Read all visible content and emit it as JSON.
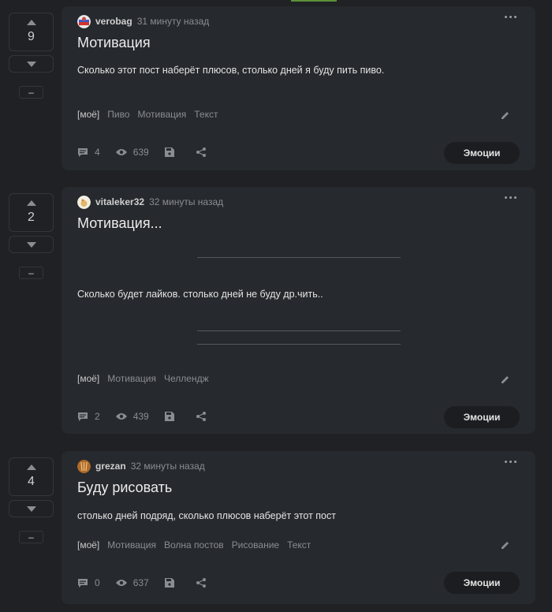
{
  "posts": [
    {
      "rating": "9",
      "hide_label": "–",
      "author": "verobag",
      "time": "31 минуту назад",
      "title": "Мотивация",
      "text": "Сколько этот пост наберёт плюсов, столько дней я буду пить пиво.",
      "tags": [
        "[моё]",
        "Пиво",
        "Мотивация",
        "Текст"
      ],
      "comments": "4",
      "views": "639",
      "emotions_label": "Эмоции"
    },
    {
      "rating": "2",
      "hide_label": "–",
      "author": "vitaleker32",
      "time": "32 минуты назад",
      "title": "Мотивация...",
      "text": "Сколько будет лайков. столько дней не буду др.чить..",
      "tags": [
        "[моё]",
        "Мотивация",
        "Челлендж"
      ],
      "comments": "2",
      "views": "439",
      "emotions_label": "Эмоции"
    },
    {
      "rating": "4",
      "hide_label": "–",
      "author": "grezan",
      "time": "32 минуты назад",
      "title": "Буду рисовать",
      "text": "столько дней подряд, сколько плюсов наберёт этот пост",
      "tags": [
        "[моё]",
        "Мотивация",
        "Волна постов",
        "Рисование",
        "Текст"
      ],
      "comments": "0",
      "views": "637",
      "emotions_label": "Эмоции"
    }
  ],
  "icons": {
    "comments": "comment-icon",
    "views": "eye-icon",
    "save": "save-icon",
    "share": "share-icon",
    "edit": "pencil-icon",
    "more": "more-dots-icon",
    "upvote": "upvote-arrow-icon",
    "downvote": "downvote-arrow-icon"
  },
  "colors": {
    "background": "#1f2124",
    "card": "#26292d",
    "muted": "#8a8d91",
    "accent": "#5d8f3a"
  }
}
